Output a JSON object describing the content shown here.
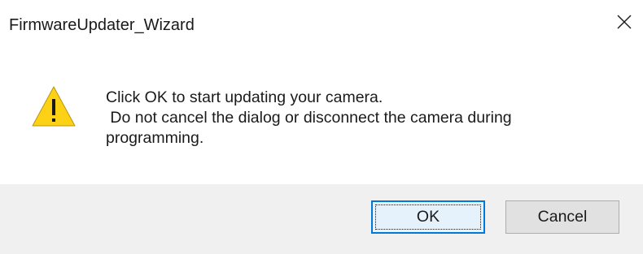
{
  "window": {
    "title": "FirmwareUpdater_Wizard",
    "close_icon": "close-icon"
  },
  "content": {
    "icon": "warning-icon",
    "message": "Click OK to start updating your camera.\n Do not cancel the dialog or disconnect the camera during\nprogramming."
  },
  "buttons": {
    "ok_label": "OK",
    "cancel_label": "Cancel"
  },
  "colors": {
    "warning_fill": "#fcd116",
    "focus_border": "#0078d7",
    "button_bar": "#f0f0f0"
  }
}
